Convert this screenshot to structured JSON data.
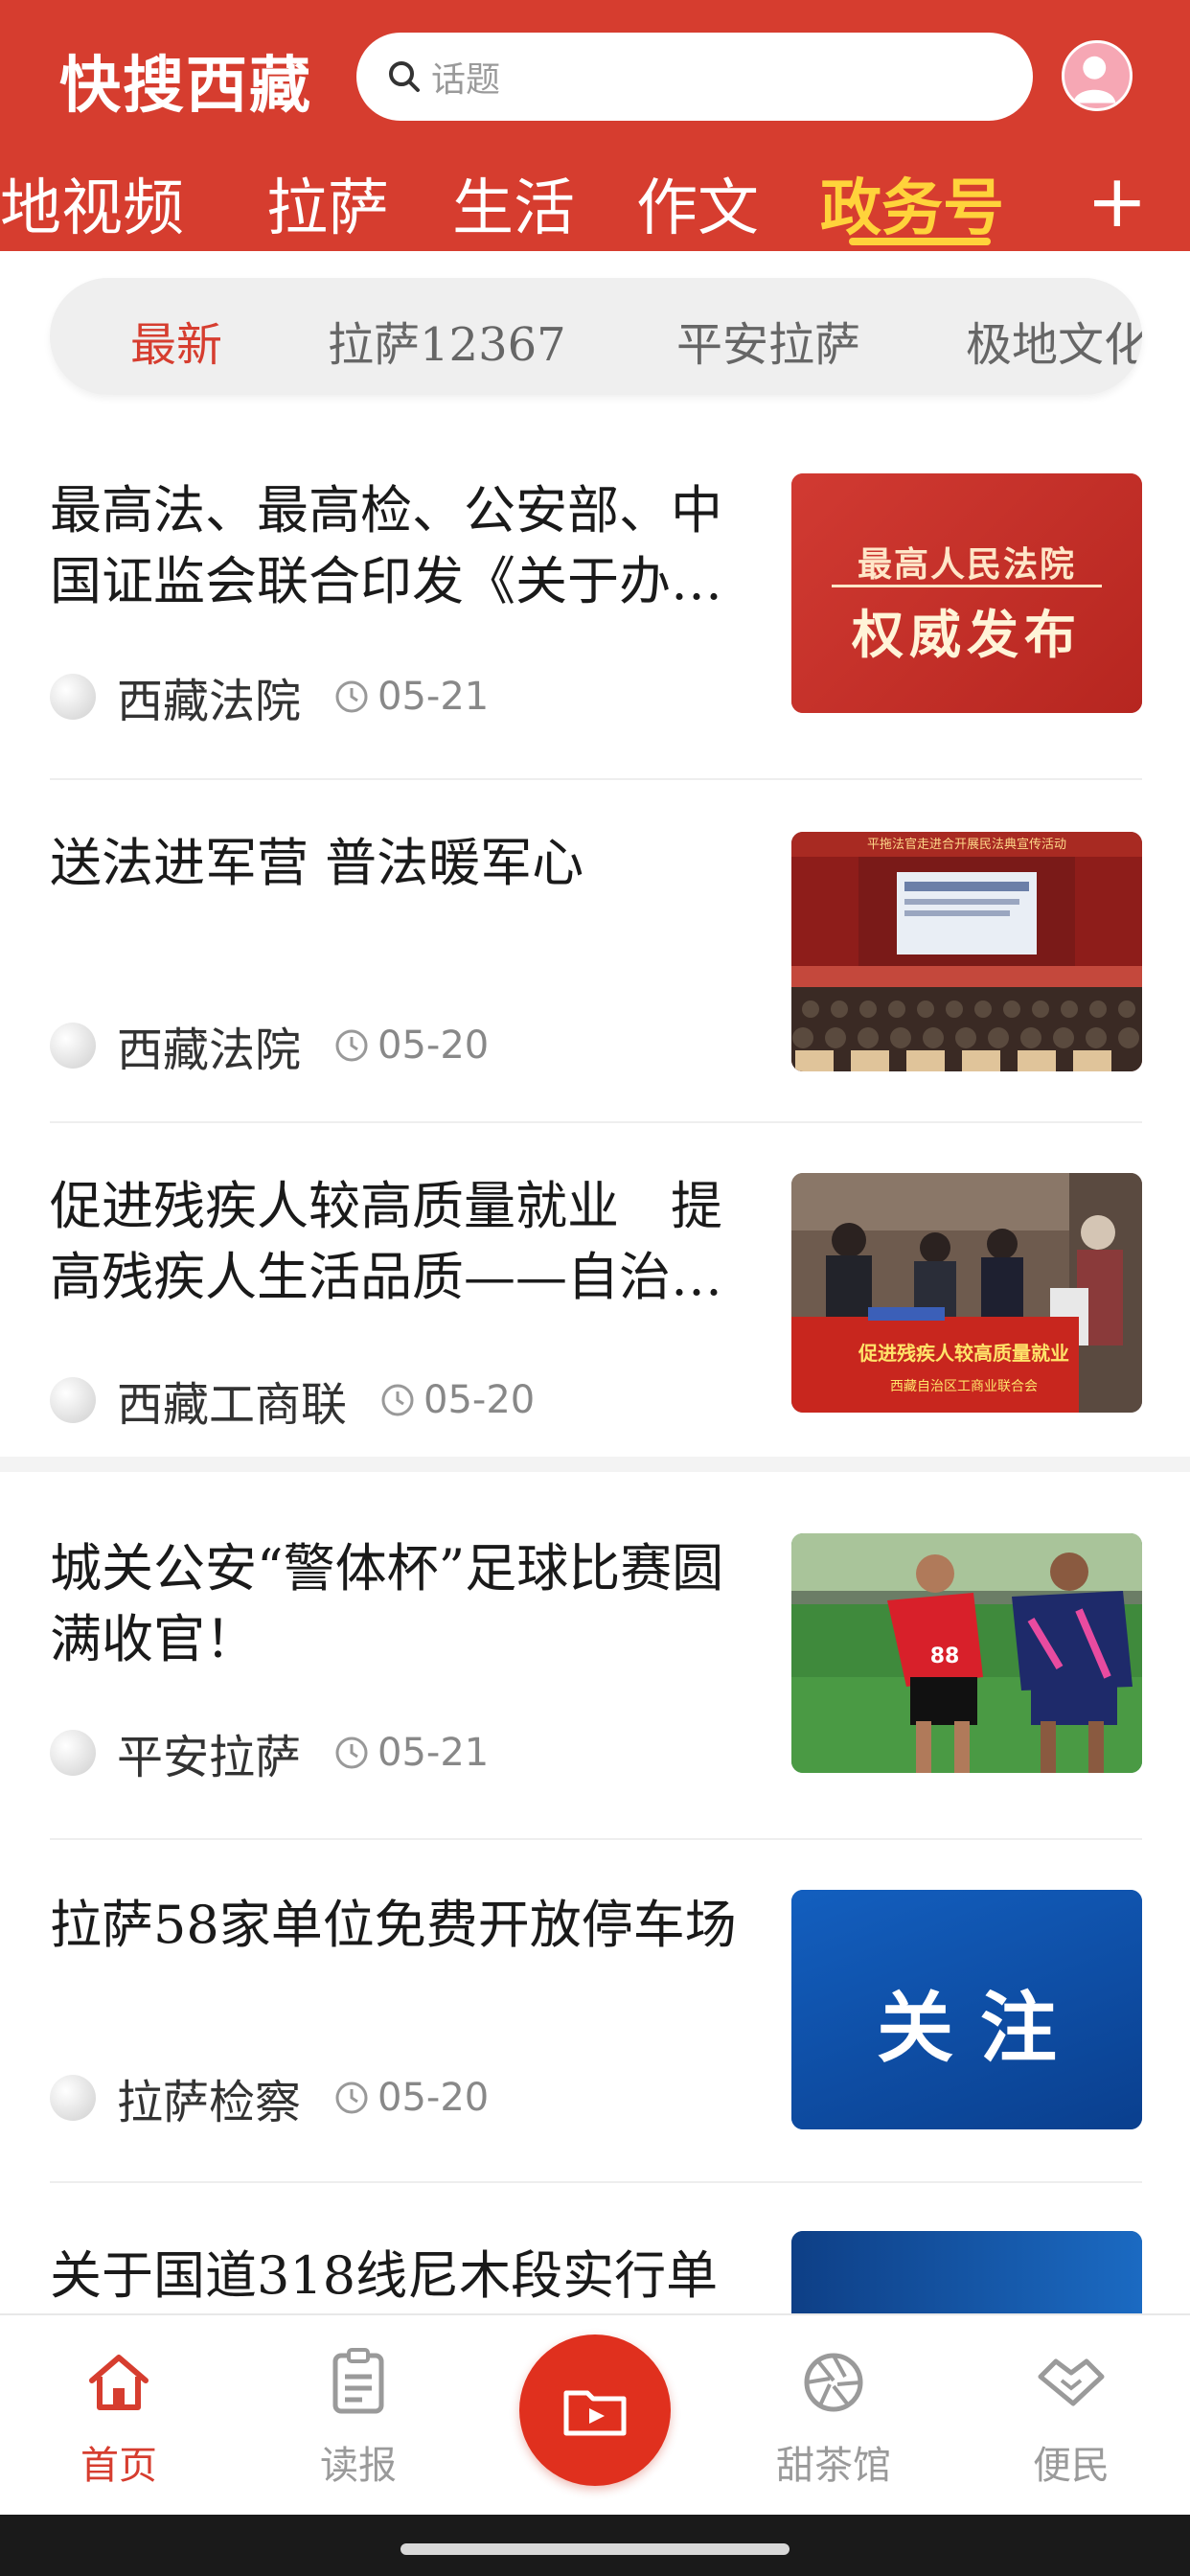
{
  "header": {
    "brand": "快搜西藏",
    "search_placeholder": "话题",
    "channels": [
      "极地视频",
      "拉萨",
      "生活",
      "作文",
      "政务号"
    ],
    "active_channel": "政务号"
  },
  "subtabs": [
    "最新",
    "拉萨12367",
    "平安拉萨",
    "极地文化"
  ],
  "articles": [
    {
      "title": "最高法、最高检、公安部、中国证监会联合印发《关于办…",
      "source": "西藏法院",
      "date": "05-21",
      "thumb_text_line1": "最高人民法院",
      "thumb_text_line2": "权威发布"
    },
    {
      "title": "送法进军营 普法暖军心",
      "source": "西藏法院",
      "date": "05-20",
      "thumb_banner": "平拖法官走进合开展民法典宣传活动"
    },
    {
      "title": "促进残疾人较高质量就业　提高残疾人生活品质——自治…",
      "source": "西藏工商联",
      "date": "05-20",
      "thumb_banner": "促进残疾人较高质量就业",
      "thumb_sub": "西藏自治区工商业联合会"
    },
    {
      "title": "城关公安“警体杯”足球比赛圆满收官！",
      "source": "平安拉萨",
      "date": "05-21",
      "thumb_number": "88"
    },
    {
      "title": "拉萨58家单位免费开放停车场",
      "source": "拉萨检察",
      "date": "05-20",
      "thumb_text": "关 注"
    },
    {
      "title": "关于国道318线尼木段实行单"
    }
  ],
  "tabbar": {
    "items": [
      "首页",
      "读报",
      "甜茶馆",
      "便民"
    ],
    "active": "首页"
  },
  "colors": {
    "brand_red": "#d63d2f",
    "active_channel": "#ffd33b",
    "fab": "#e0301e"
  }
}
